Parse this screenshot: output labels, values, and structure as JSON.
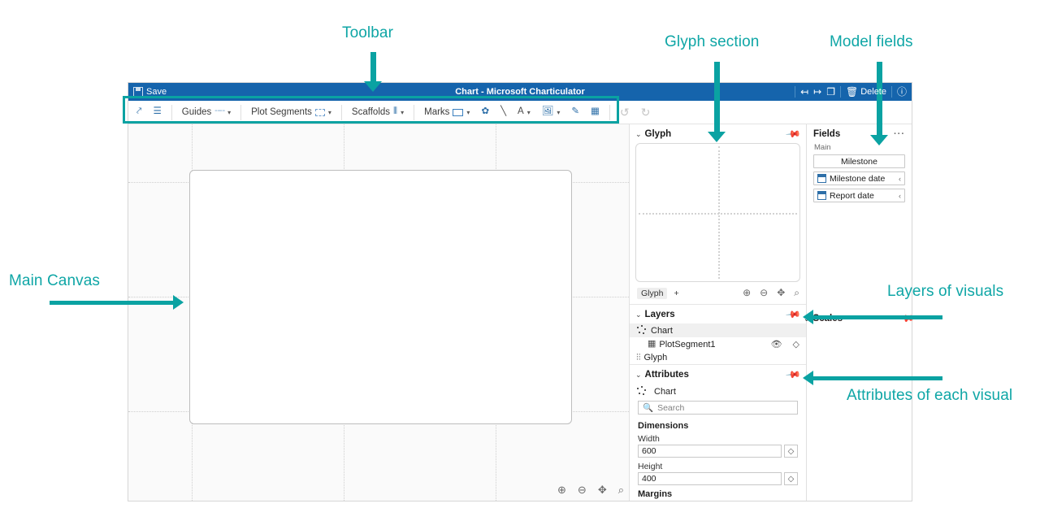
{
  "annotations": [
    {
      "id": "toolbar",
      "label": "Toolbar"
    },
    {
      "id": "glyph_section",
      "label": "Glyph section"
    },
    {
      "id": "model_fields",
      "label": "Model fields"
    },
    {
      "id": "main_canvas",
      "label": "Main Canvas"
    },
    {
      "id": "layers_of_visuals",
      "label": "Layers of visuals"
    },
    {
      "id": "attributes_of_each_visual",
      "label": "Attributes of each visual"
    }
  ],
  "accent_color": "#0aa2a2",
  "titlebar": {
    "save_label": "Save",
    "title": "Chart - Microsoft Charticulator",
    "delete_label": "Delete",
    "icons": {
      "save": "save-icon",
      "prev": "arrow-to-left-icon",
      "next": "arrow-to-right-icon",
      "copy": "copy-icon",
      "trash": "trash-icon",
      "help": "help-circle-icon"
    },
    "bg": "#1564ac"
  },
  "toolbar": {
    "items": [
      {
        "name": "link-tool",
        "icon": "link-icon",
        "label": "",
        "caret": false
      },
      {
        "name": "order-tool",
        "icon": "numbered-list-icon",
        "label": "",
        "caret": false
      },
      {
        "name": "guides",
        "icon": "guide-dash-icon",
        "label": "Guides",
        "caret": true
      },
      {
        "name": "plot-segments",
        "icon": "dashed-rect-icon",
        "label": "Plot Segments",
        "caret": true
      },
      {
        "name": "scaffolds",
        "icon": "scaffold-bars-icon",
        "label": "Scaffolds",
        "caret": true
      },
      {
        "name": "marks",
        "icon": "rect-icon",
        "label": "Marks",
        "caret": true
      },
      {
        "name": "symbol-mark",
        "icon": "symbol-icon",
        "label": "",
        "caret": false
      },
      {
        "name": "line-mark",
        "icon": "line-icon",
        "label": "",
        "caret": false
      },
      {
        "name": "text-mark",
        "icon": "text-a-icon",
        "label": "A",
        "caret": true
      },
      {
        "name": "image-mark",
        "icon": "image-icon",
        "label": "",
        "caret": true
      },
      {
        "name": "pen-tool",
        "icon": "pencil-icon",
        "label": "",
        "caret": false
      },
      {
        "name": "data-axis",
        "icon": "data-axis-icon",
        "label": "",
        "caret": false
      }
    ],
    "undo_icon": "undo-arrow-icon",
    "redo_icon": "redo-arrow-icon"
  },
  "canvas": {
    "zoom_buttons": [
      {
        "name": "zoom-in-button",
        "glyph": "⊕"
      },
      {
        "name": "zoom-out-button",
        "glyph": "⊖"
      },
      {
        "name": "fit-to-view-button",
        "glyph": "✥"
      },
      {
        "name": "zoom-to-selection-button",
        "glyph": "⌕"
      }
    ]
  },
  "glyph_panel": {
    "title": "Glyph",
    "tab_label": "Glyph",
    "add_label": "+",
    "zoom_buttons": [
      {
        "name": "glyph-zoom-in-button",
        "glyph": "⊕"
      },
      {
        "name": "glyph-zoom-out-button",
        "glyph": "⊖"
      },
      {
        "name": "glyph-fit-button",
        "glyph": "✥"
      },
      {
        "name": "glyph-zoom-selection-button",
        "glyph": "⌕"
      }
    ]
  },
  "layers_panel": {
    "title": "Layers",
    "items": [
      {
        "label": "Chart",
        "icon": "scatter-icon",
        "selected": true,
        "indent": false,
        "actions": []
      },
      {
        "label": "PlotSegment1",
        "icon": "grid-icon",
        "selected": false,
        "indent": true,
        "actions": [
          "eye-icon",
          "eraser-icon"
        ]
      },
      {
        "label": "Glyph",
        "icon": "glyph-icon",
        "selected": false,
        "indent": false,
        "actions": []
      }
    ]
  },
  "scales_panel": {
    "title": "Scales"
  },
  "attributes_panel": {
    "title": "Attributes",
    "subject": "Chart",
    "search_placeholder": "Search",
    "groups": [
      {
        "title": "Dimensions",
        "fields": [
          {
            "label": "Width",
            "value": "600"
          },
          {
            "label": "Height",
            "value": "400"
          }
        ]
      },
      {
        "title": "Margins",
        "fields": []
      }
    ]
  },
  "fields_panel": {
    "title": "Fields",
    "more_label": "···",
    "section_label": "Main",
    "items": [
      {
        "label": "Milestone",
        "icon": "",
        "centered": true,
        "expander": ""
      },
      {
        "label": "Milestone date",
        "icon": "calendar-icon",
        "centered": false,
        "expander": "‹"
      },
      {
        "label": "Report date",
        "icon": "calendar-icon",
        "centered": false,
        "expander": "‹"
      }
    ]
  }
}
